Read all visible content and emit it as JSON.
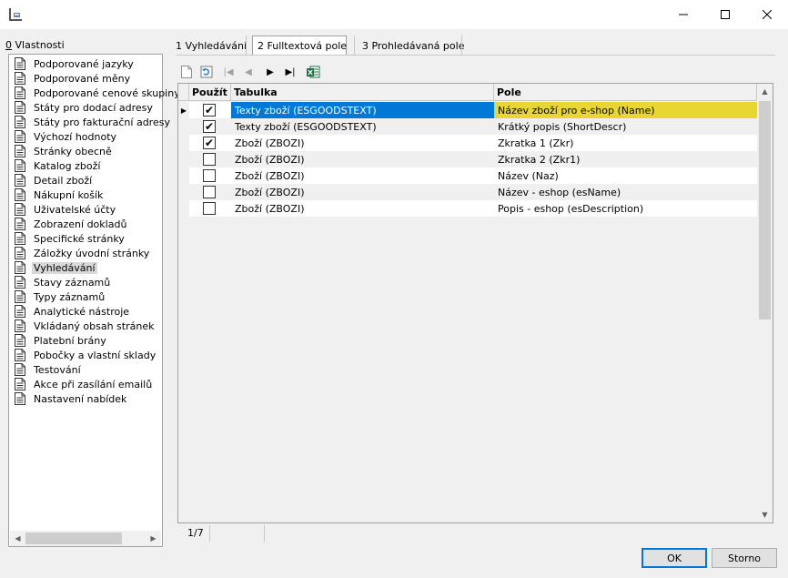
{
  "panel": {
    "label_key": "0",
    "label_rest": " Vlastnosti",
    "items": [
      "Podporované jazyky",
      "Podporované měny",
      "Podporované cenové skupiny",
      "Státy pro dodací adresy",
      "Státy pro fakturační adresy",
      "Výchozí hodnoty",
      "Stránky obecně",
      "Katalog zboží",
      "Detail zboží",
      "Nákupní košík",
      "Uživatelské účty",
      "Zobrazení dokladů",
      "Specifické stránky",
      "Záložky úvodní stránky",
      "Vyhledávání",
      "Stavy záznamů",
      "Typy záznamů",
      "Analytické nástroje",
      "Vkládaný obsah stránek",
      "Platební brány",
      "Pobočky a vlastní sklady",
      "Testování",
      "Akce při zasílání emailů",
      "Nastavení nabídek"
    ],
    "selected_index": 14
  },
  "tabs": [
    "1 Vyhledávání",
    "2 Fulltextová pole",
    "3 Prohledávaná pole"
  ],
  "active_tab": 1,
  "grid": {
    "columns": [
      "Použít",
      "Tabulka",
      "Pole"
    ],
    "rows": [
      {
        "use": true,
        "table": "Texty zboží (ESGOODSTEXT)",
        "field": "Název zboží pro e-shop (Name)"
      },
      {
        "use": true,
        "table": "Texty zboží (ESGOODSTEXT)",
        "field": "Krátký popis (ShortDescr)"
      },
      {
        "use": true,
        "table": "Zboží (ZBOZI)",
        "field": "Zkratka 1 (Zkr)"
      },
      {
        "use": false,
        "table": "Zboží (ZBOZI)",
        "field": "Zkratka 2 (Zkr1)"
      },
      {
        "use": false,
        "table": "Zboží (ZBOZI)",
        "field": "Název (Naz)"
      },
      {
        "use": false,
        "table": "Zboží (ZBOZI)",
        "field": "Název - eshop (esName)"
      },
      {
        "use": false,
        "table": "Zboží (ZBOZI)",
        "field": "Popis - eshop (esDescription)"
      }
    ],
    "selected_row": 0,
    "check_glyph": "✔"
  },
  "status": {
    "record_counter": "1/7"
  },
  "buttons": {
    "ok": "OK",
    "cancel": "Storno"
  },
  "colors": {
    "selection_blue": "#0078d7",
    "row_highlight_yellow": "#e8d632"
  }
}
